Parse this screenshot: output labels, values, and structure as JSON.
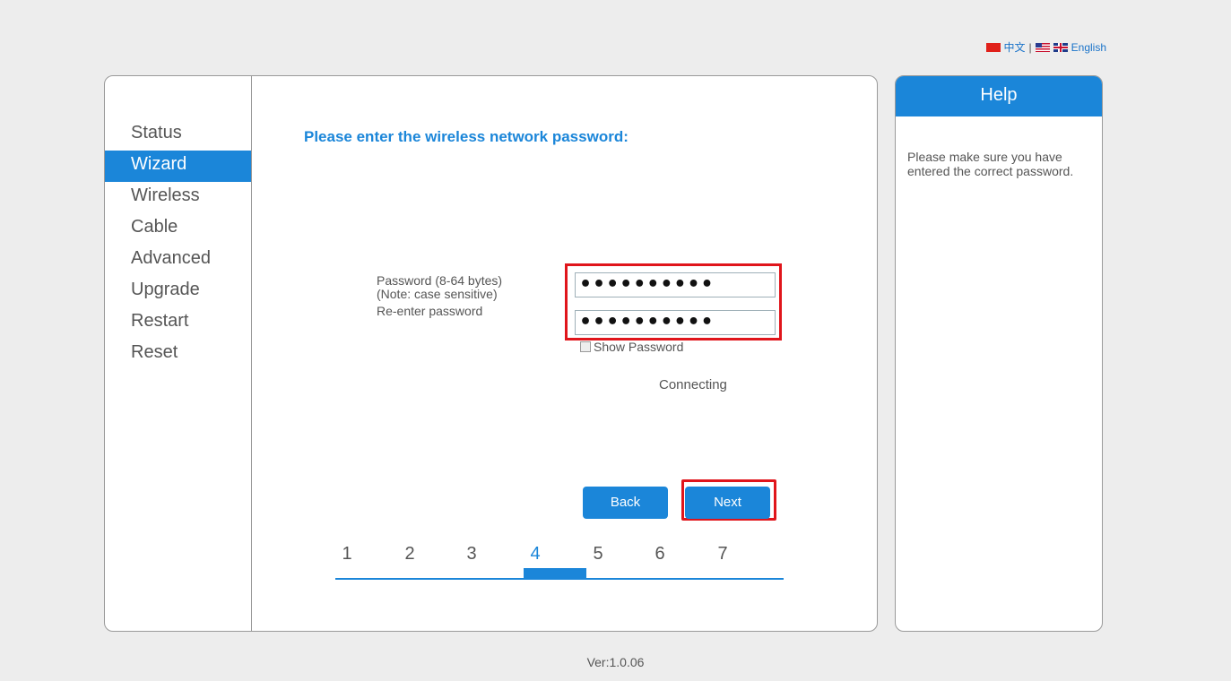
{
  "language": {
    "chinese_label": "中文",
    "separator": "|",
    "english_label": "English"
  },
  "sidebar": {
    "items": [
      {
        "label": "Status"
      },
      {
        "label": "Wizard"
      },
      {
        "label": "Wireless"
      },
      {
        "label": "Cable"
      },
      {
        "label": "Advanced"
      },
      {
        "label": "Upgrade"
      },
      {
        "label": "Restart"
      },
      {
        "label": "Reset"
      }
    ],
    "active": "Wizard"
  },
  "wizard": {
    "title": "Please enter the wireless network password:",
    "password_label": "Password (8-64 bytes)",
    "password_note": "(Note: case sensitive)",
    "reenter_label": "Re-enter password",
    "password_value": "••••••••••",
    "reenter_value": "••••••••••",
    "show_password_label": "Show Password",
    "status_text": "Connecting",
    "back_label": "Back",
    "next_label": "Next",
    "steps": [
      "1",
      "2",
      "3",
      "4",
      "5",
      "6",
      "7"
    ],
    "current_step": 4
  },
  "help": {
    "title": "Help",
    "text": "Please make sure you have entered the correct password."
  },
  "footer": {
    "version": "Ver:1.0.06"
  },
  "colors": {
    "accent": "#1b86d9",
    "highlight_border": "#e0151b"
  }
}
